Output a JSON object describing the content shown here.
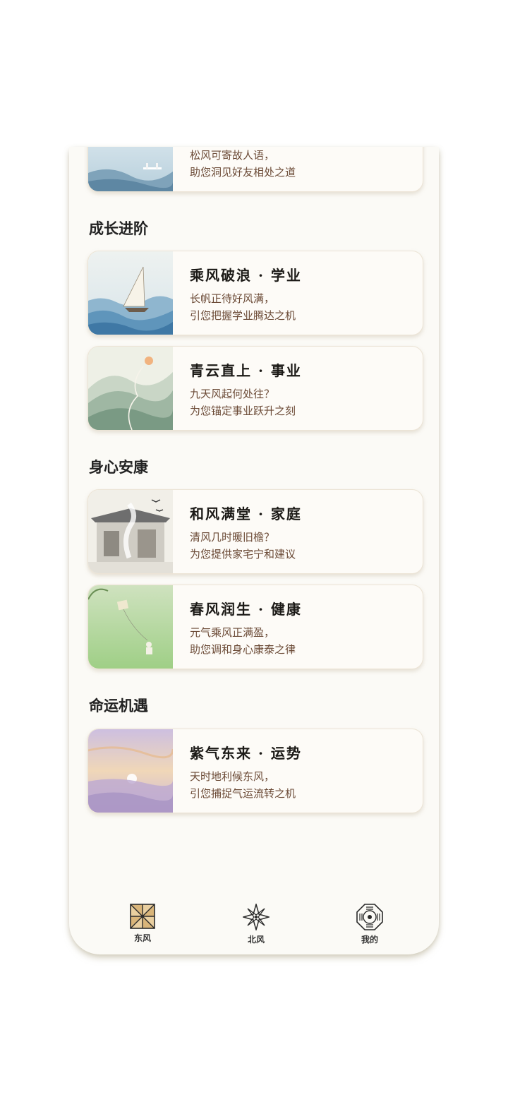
{
  "sections": [
    {
      "title": "",
      "cards": [
        {
          "title": "",
          "line1": "松风可寄故人语，",
          "line2": "助您洞见好友相处之道"
        }
      ]
    },
    {
      "title": "成长进阶",
      "cards": [
        {
          "title": "乘风破浪 · 学业",
          "line1": "长帆正待好风满，",
          "line2": "引您把握学业腾达之机"
        },
        {
          "title": "青云直上 · 事业",
          "line1": "九天风起何处往？",
          "line2": "为您锚定事业跃升之刻"
        }
      ]
    },
    {
      "title": "身心安康",
      "cards": [
        {
          "title": "和风满堂 · 家庭",
          "line1": "清风几时暖旧檐？",
          "line2": "为您提供家宅宁和建议"
        },
        {
          "title": "春风润生 · 健康",
          "line1": "元气乘风正满盈，",
          "line2": "助您调和身心康泰之律"
        }
      ]
    },
    {
      "title": "命运机遇",
      "cards": [
        {
          "title": "紫气东来 · 运势",
          "line1": "天时地利候东风，",
          "line2": "引您捕捉气运流转之机"
        }
      ]
    }
  ],
  "tabs": [
    {
      "label": "东风",
      "icon": "pinwheel-icon",
      "active": true
    },
    {
      "label": "北风",
      "icon": "compass-star-icon",
      "active": false
    },
    {
      "label": "我的",
      "icon": "bagua-icon",
      "active": false
    }
  ],
  "colors": {
    "background": "#fbfaf6",
    "card": "#fdfbf7",
    "title_text": "#1c1a17",
    "body_text": "#6b4a36",
    "active_icon": "#e9cfa0"
  }
}
